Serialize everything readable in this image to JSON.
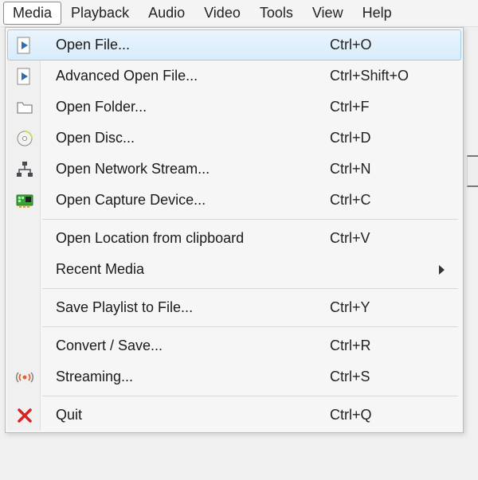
{
  "menubar": {
    "items": [
      {
        "label": "Media",
        "active": true
      },
      {
        "label": "Playback"
      },
      {
        "label": "Audio"
      },
      {
        "label": "Video"
      },
      {
        "label": "Tools"
      },
      {
        "label": "View"
      },
      {
        "label": "Help"
      }
    ]
  },
  "dropdown": {
    "items": [
      {
        "type": "item",
        "icon": "play-file-icon",
        "label": "Open File...",
        "shortcut": "Ctrl+O",
        "highlight": true
      },
      {
        "type": "item",
        "icon": "play-file-icon",
        "label": "Advanced Open File...",
        "shortcut": "Ctrl+Shift+O"
      },
      {
        "type": "item",
        "icon": "folder-icon",
        "label": "Open Folder...",
        "shortcut": "Ctrl+F"
      },
      {
        "type": "item",
        "icon": "disc-icon",
        "label": "Open Disc...",
        "shortcut": "Ctrl+D"
      },
      {
        "type": "item",
        "icon": "network-icon",
        "label": "Open Network Stream...",
        "shortcut": "Ctrl+N"
      },
      {
        "type": "item",
        "icon": "capture-card-icon",
        "label": "Open Capture Device...",
        "shortcut": "Ctrl+C"
      },
      {
        "type": "separator"
      },
      {
        "type": "item",
        "icon": "",
        "label": "Open Location from clipboard",
        "shortcut": "Ctrl+V"
      },
      {
        "type": "item",
        "icon": "",
        "label": "Recent Media",
        "shortcut": "",
        "submenu": true
      },
      {
        "type": "separator"
      },
      {
        "type": "item",
        "icon": "",
        "label": "Save Playlist to File...",
        "shortcut": "Ctrl+Y"
      },
      {
        "type": "separator"
      },
      {
        "type": "item",
        "icon": "",
        "label": "Convert / Save...",
        "shortcut": "Ctrl+R"
      },
      {
        "type": "item",
        "icon": "stream-icon",
        "label": "Streaming...",
        "shortcut": "Ctrl+S"
      },
      {
        "type": "separator"
      },
      {
        "type": "item",
        "icon": "quit-icon",
        "label": "Quit",
        "shortcut": "Ctrl+Q"
      }
    ]
  }
}
